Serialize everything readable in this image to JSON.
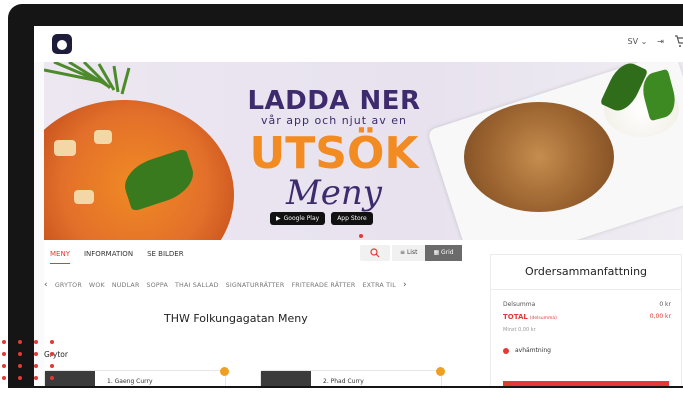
{
  "header": {
    "lang": "SV",
    "cart_count": "0"
  },
  "banner": {
    "line1": "LADDA NER",
    "line2": "vår app och njut av en",
    "line3": "UTSÖK",
    "line4": "Meny",
    "google_label": "Google Play",
    "apple_label": "App Store"
  },
  "tabs": [
    "MENY",
    "INFORMATION",
    "SE BILDER"
  ],
  "view": {
    "list": "List",
    "grid": "Grid"
  },
  "categories": [
    "GRYTOR",
    "WOK",
    "NUDLAR",
    "SOPPA",
    "THAI SALLAD",
    "SIGNATURRÄTTER",
    "FRITERADE RÄTTER",
    "EXTRA TIL"
  ],
  "menu_title": "THW Folkungagatan Meny",
  "section": "Grytor",
  "cards": [
    "1. Gaeng Curry",
    "2. Phad Curry"
  ],
  "order": {
    "title": "Ordersammanfattning",
    "subtotal_label": "Delsumma",
    "subtotal_value": "0 kr",
    "total_label": "TOTAL",
    "total_suffix": "(delsumma)",
    "total_value": "0,00 kr",
    "min_text": "Minst 0,00 kr",
    "pickup": "avhämtning"
  },
  "colors": {
    "accent": "#e53935",
    "purple": "#3d2b6e",
    "orange": "#f28b22"
  }
}
